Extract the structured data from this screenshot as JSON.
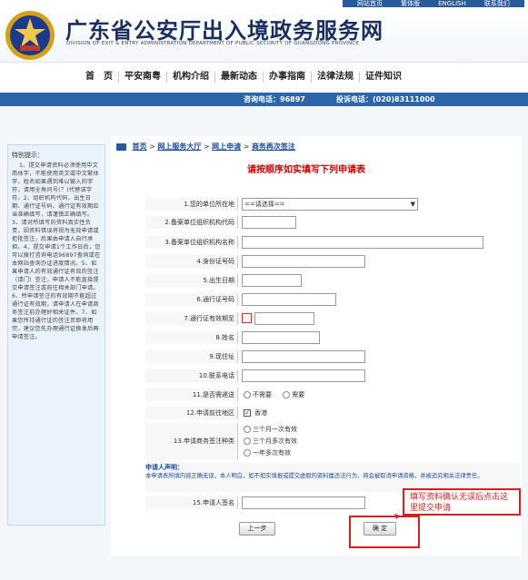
{
  "top_links": [
    "网站首页",
    "繁体版",
    "ENGLISH",
    "联系我们"
  ],
  "site": {
    "title": "广东省公安厅出入境政务服务网",
    "subtitle": "DIVISION OF EXIT & ENTRY ADMINISTRATION DEPARTMENT OF PUBLIC SECURITY OF GUANGDONG PROVINCE"
  },
  "nav": [
    "首　页",
    "平安南粤",
    "机构介绍",
    "最新动态",
    "办事指南",
    "法律法规",
    "证件知识"
  ],
  "phones": {
    "consult": "咨询电话：96897",
    "complaint": "投诉电话：(020)83111000"
  },
  "sidebar": {
    "title": "特别提示：",
    "text": "1、提交申请资料必须使用中文简体字，不能使用英文或中文繁体字，姓名如果遇到难以输入的字符，请用全角问号(？)代替该字符。2、组织机构代码、出生日期、通行证号码、通行证有效期应当准确填写，请谨慎正确填写。3、请对所填写的资料真实性负责，因资料错误将视为无效申请或拒批签注，后果由申请人自行承担。4、提交申请1个工作日后，您可以拨打咨询电话96897查询或在本网站查询办证进度情况。5、如果申请人的有效通行证有效的签注（请门）签注，申请人不能直接提交申请签注或前往相关部门申请。6、所申请签注的有效期不能超过通行证有效期，请申请人在申请商务签注前办理好相关证件。7、如果您所持通行证的签注页即将用完，建议您先办理通行证换发后再申请签注。"
  },
  "breadcrumb": {
    "home": "首页",
    "sep": ">",
    "hall": "网上服务大厅",
    "apply": "网上申请",
    "current": "商务再次签注"
  },
  "form_heading": "请按顺序如实填写下列申请表",
  "form": {
    "f1_label": "1.您的单位所在地",
    "f1_value": "==请选择==",
    "f2_label": "2.备案单位组织机构代码",
    "f3_label": "3.备案单位组织机构名称",
    "f4_label": "4.身份证号码",
    "f5_label": "5.出生日期",
    "f6_label": "6.通行证号码",
    "f7_label": "7.通行证有效期至",
    "f8_label": "8.姓名",
    "f9_label": "9.现住址",
    "f10_label": "10.联系电话",
    "f11_label": "11.是否需递送",
    "f11_opt1": "不需要",
    "f11_opt2": "需要",
    "f12_label": "12.申请前往地区",
    "f12_value": "香港",
    "f13_label": "13.申请商务签注种类",
    "f13_opt1": "三个月一次有效",
    "f13_opt2": "三个月多次有效",
    "f13_opt3": "一年多次有效",
    "f15_label": "15.申请人签名"
  },
  "notice": {
    "title": "申请人声明：",
    "text": "本申请表所填内容正确无误，本人明白，如不如实填报或提交虚假的资料属违法行为，将会被取消申请资格，并被追究相关法律责任。"
  },
  "buttons": {
    "prev": "上一步",
    "submit": "确 定"
  },
  "callout": "填写资料确认无误后点击这里提交申请",
  "colors": {
    "accent": "#2c66a8",
    "heading_red": "#cc0000",
    "annotation_red": "#d42020"
  }
}
